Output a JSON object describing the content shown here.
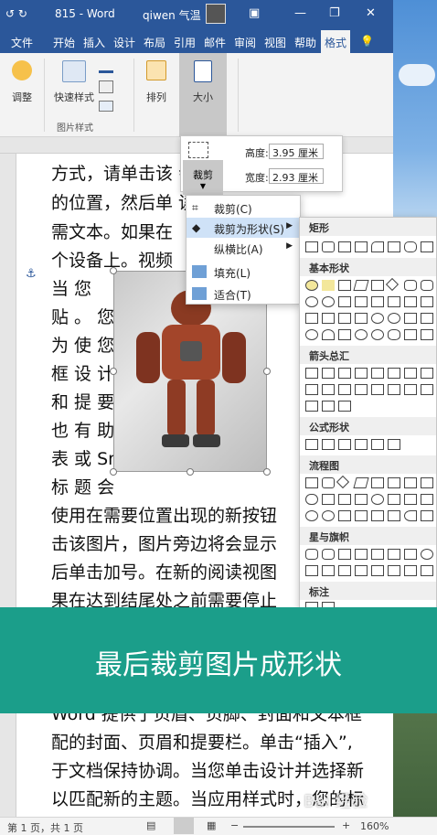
{
  "window": {
    "quick_access": "↺  ↻",
    "doc_name": "815  -  Word",
    "user": "qiwen 气温",
    "minimize": "—",
    "restore": "❐",
    "close": "✕"
  },
  "tabs": [
    {
      "label": "文件"
    },
    {
      "label": "开始"
    },
    {
      "label": "插入"
    },
    {
      "label": "设计"
    },
    {
      "label": "布局"
    },
    {
      "label": "引用"
    },
    {
      "label": "邮件"
    },
    {
      "label": "审阅"
    },
    {
      "label": "视图"
    },
    {
      "label": "帮助"
    },
    {
      "label": "格式"
    }
  ],
  "ribbon": {
    "adjust": "调整",
    "quick_styles": "快速样式",
    "picture_styles_group": "图片样式",
    "arrange": "排列",
    "size": "大小"
  },
  "size_popup": {
    "height_label": "高度:",
    "height_value": "3.95 厘米",
    "width_label": "宽度:",
    "width_value": "2.93 厘米",
    "crop": "裁剪"
  },
  "crop_menu": {
    "items": [
      {
        "label": "裁剪(C)"
      },
      {
        "label": "裁剪为形状(S)"
      },
      {
        "label": "纵横比(A)"
      },
      {
        "label": "填充(L)"
      },
      {
        "label": "适合(T)"
      }
    ]
  },
  "gallery": {
    "sections": [
      "矩形",
      "基本形状",
      "箭头总汇",
      "公式形状",
      "流程图",
      "星与旗帜",
      "标注"
    ]
  },
  "document": {
    "lines": [
      "方式，请单击该                       会显示",
      "的位置，然后单                       读视图",
      "需文本。如果在",
      "个设备上。视频",
      "当    您",
      "贴    。                             您",
      "为    使                             您",
      "框    设                             计",
      "和    提                             要",
      "也    有                             助",
      "表    或                             Sm",
      "标    题                             会",
      "使用在需要位置出现的新按钮",
      "击该图片，图片旁边将会显示",
      "后单击加号。在新的阅读视图",
      "果在达到结尾处之前需要停止",
      "Word 提供了页眉、页脚、封面和文本框",
      "配的封面、页眉和提要栏。单击“插入”,",
      "于文档保持协调。当您单击设计并选择新",
      "以匹配新的主题。当应用样式时，您的标"
    ]
  },
  "banner": {
    "caption": "最后裁剪图片成形状"
  },
  "status": {
    "page_info": "第 1 页，共 1 页",
    "zoom": "160%",
    "minus": "−",
    "plus": "+"
  },
  "watermark": "Bai 经验"
}
